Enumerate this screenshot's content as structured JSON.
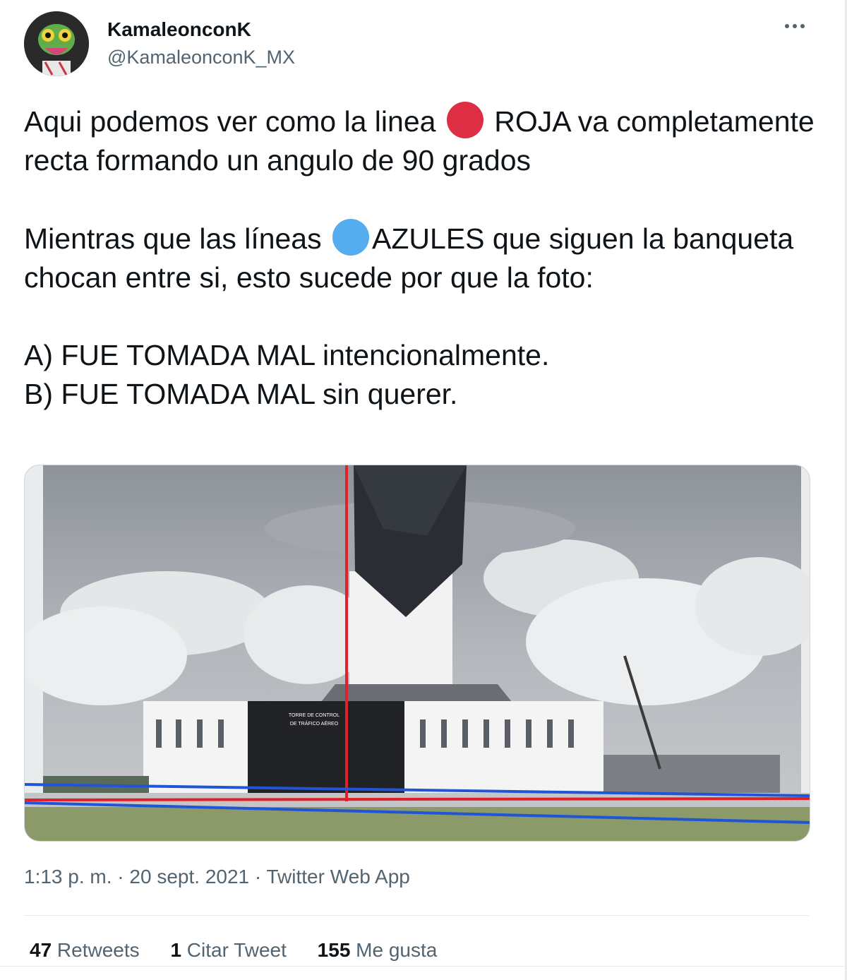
{
  "author": {
    "name": "KamaleonconK",
    "handle": "@KamaleonconK_MX",
    "more_icon": "more-horizontal-icon"
  },
  "text": {
    "p1_a": "Aqui podemos ver como la linea ",
    "p1_b": " ROJA va completamente recta formando un angulo de 90 grados",
    "p2_a": "Mientras que las líneas ",
    "p2_b": "AZULES que siguen la banqueta chocan entre si, esto sucede por que la foto:",
    "option_a": "A) FUE TOMADA MAL intencionalmente.",
    "option_b": "B) FUE TOMADA MAL sin querer."
  },
  "emojis": {
    "red": "#dd2e44",
    "blue": "#55acee"
  },
  "media": {
    "sign_line1": "TORRE DE CONTROL",
    "sign_line2": "DE TRÁFICO AÉREO",
    "red_line_color": "#e0202a",
    "blue_line_color": "#1f55d6"
  },
  "meta": {
    "time": "1:13 p. m.",
    "date": "20 sept. 2021",
    "source": "Twitter Web App",
    "separator": " · "
  },
  "stats": {
    "retweets_count": "47",
    "retweets_label": " Retweets",
    "quotes_count": "1",
    "quotes_label": " Citar Tweet",
    "likes_count": "155",
    "likes_label": " Me gusta"
  }
}
